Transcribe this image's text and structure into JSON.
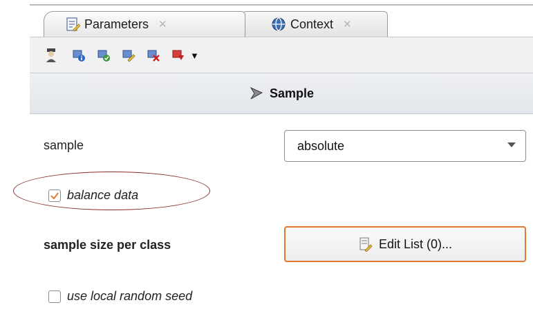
{
  "tabs": [
    {
      "label": "Parameters",
      "icon": "parameters-icon"
    },
    {
      "label": "Context",
      "icon": "globe-icon"
    }
  ],
  "toolbar": {
    "icons": [
      "expert-mode-icon",
      "info-icon",
      "check-icon",
      "edit-icon",
      "delete-icon",
      "export-icon",
      "dropdown-arrow-icon"
    ]
  },
  "section": {
    "title": "Sample"
  },
  "params": {
    "sample_label": "sample",
    "sample_value": "absolute",
    "balance_label": "balance data",
    "balance_checked": true,
    "size_label": "sample size per class",
    "edit_list_label": "Edit List (0)...",
    "seed_label": "use local random seed",
    "seed_checked": false
  },
  "colors": {
    "accent": "#e07a2e",
    "annotation": "#8a2a2a",
    "section_bg": "#e6e9ee"
  }
}
